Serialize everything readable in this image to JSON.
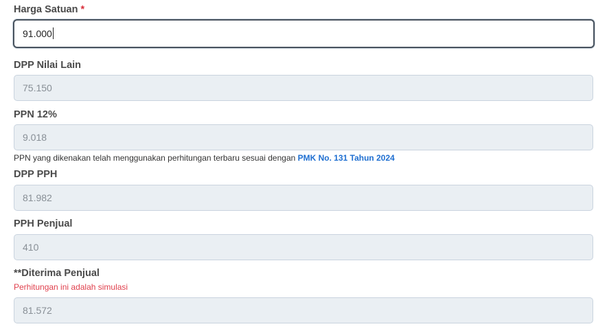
{
  "form": {
    "harga_satuan": {
      "label": "Harga Satuan",
      "required_mark": "*",
      "value": "91.000"
    },
    "dpp_nilai_lain": {
      "label": "DPP Nilai Lain",
      "value": "75.150"
    },
    "ppn": {
      "label": "PPN 12%",
      "value": "9.018",
      "note_text": "PPN yang dikenakan telah menggunakan perhitungan terbaru sesuai dengan ",
      "note_link": "PMK No. 131 Tahun 2024"
    },
    "dpp_pph": {
      "label": "DPP PPH",
      "value": "81.982"
    },
    "pph_penjual": {
      "label": "PPH Penjual",
      "value": "410"
    },
    "diterima_penjual": {
      "label": "**Diterima Penjual",
      "simulation_note": "Perhitungan ini adalah simulasi",
      "value": "81.572"
    }
  },
  "colors": {
    "required": "#d9303c",
    "link": "#1f6fd1",
    "simulation_note": "#e0404d",
    "readonly_bg": "#eaeff3"
  }
}
